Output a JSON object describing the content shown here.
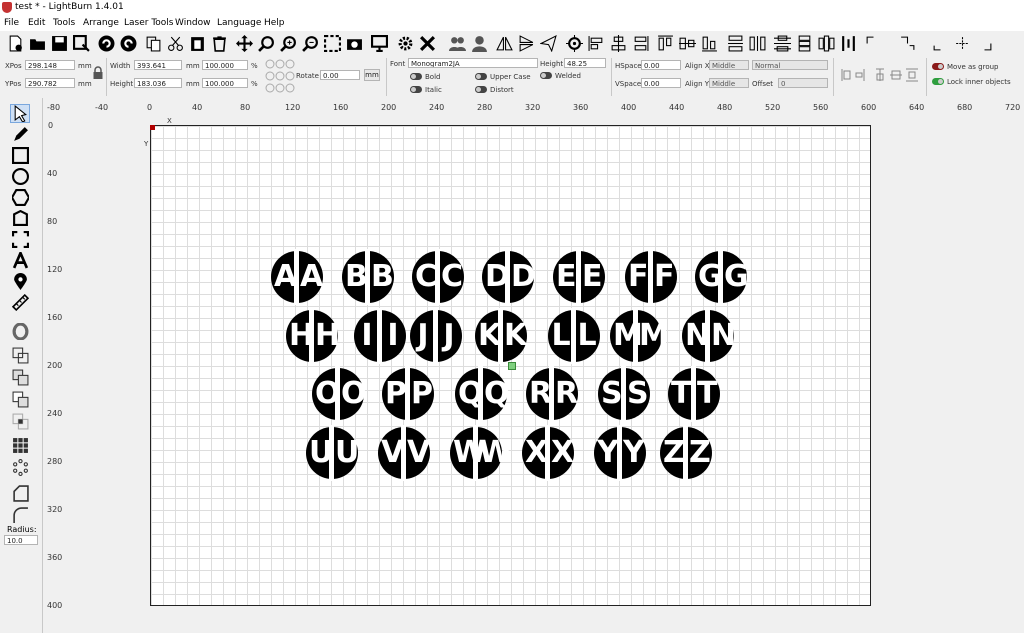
{
  "window": {
    "title": "test * - LightBurn 1.4.01"
  },
  "menu": [
    "File",
    "Edit",
    "Tools",
    "Arrange",
    "Laser Tools",
    "Window",
    "Language",
    "Help"
  ],
  "toolbar_icons": [
    "new-file-icon",
    "open-folder-icon",
    "save-icon",
    "save-as-icon",
    "undo-icon",
    "redo-icon",
    "copy-icon",
    "cut-icon",
    "paste-icon",
    "delete-icon",
    "move-icon",
    "zoom-in-icon",
    "zoom-plus-icon",
    "zoom-minus-icon",
    "zoom-frame-icon",
    "camera-icon",
    "monitor-icon",
    "settings-icon",
    "tools-icon",
    "group-icon",
    "user-icon",
    "mirror-h-icon",
    "mirror-v-icon",
    "send-icon",
    "target-icon",
    "align-left-icon",
    "align-center-icon",
    "align-right-icon",
    "align-top-icon",
    "align-middle-icon",
    "align-bottom-icon",
    "distribute-h-icon",
    "distribute-v-icon",
    "distribute-icon",
    "corner-tl-icon",
    "corner-tr-icon",
    "corner-bl-icon",
    "center-icon",
    "corner-br-icon"
  ],
  "props": {
    "xpos_label": "XPos",
    "xpos": "298.148",
    "ypos_label": "YPos",
    "ypos": "290.782",
    "mm": "mm",
    "width_label": "Width",
    "width": "393.641",
    "height_label": "Height",
    "height": "183.036",
    "scale_w": "100.000",
    "scale_h": "100.000",
    "pct": "%",
    "rotate_label": "Rotate",
    "rotate": "0.00",
    "rotate_unit": "mm",
    "font_label": "Font",
    "font": "Monogram2JA",
    "text_height_label": "Height",
    "text_height": "48.25",
    "bold": "Bold",
    "italic": "Italic",
    "upper_case": "Upper Case",
    "distort": "Distort",
    "welded": "Welded",
    "hspace_label": "HSpace",
    "hspace": "0.00",
    "vspace_label": "VSpace",
    "vspace": "0.00",
    "alignx_label": "Align X",
    "alignx": "Middle",
    "aligny_label": "Align Y",
    "aligny": "Middle",
    "mode": "Normal",
    "offset_label": "Offset",
    "offset": "0",
    "move_as_group": "Move as group",
    "lock_inner": "Lock inner objects"
  },
  "left_tools": {
    "radius_label": "Radius:",
    "radius": "10.0"
  },
  "rulers": {
    "h": [
      "-80",
      "-40",
      "0",
      "40",
      "80",
      "120",
      "160",
      "200",
      "240",
      "280",
      "320",
      "360",
      "400",
      "440",
      "480",
      "520",
      "560",
      "600",
      "640",
      "680",
      "720"
    ],
    "v": [
      "0",
      "40",
      "80",
      "120",
      "160",
      "200",
      "240",
      "280",
      "320",
      "360",
      "400"
    ],
    "x_axis": "X",
    "y_axis": "Y"
  },
  "monograms": [
    "AA",
    "BB",
    "CC",
    "DD",
    "EE",
    "FF",
    "GG",
    "HH",
    "II",
    "JJ",
    "KK",
    "LL",
    "MM",
    "NN",
    "OO",
    "PP",
    "QQ",
    "RR",
    "SS",
    "TT",
    "UU",
    "VV",
    "WW",
    "XX",
    "YY",
    "ZZ"
  ]
}
